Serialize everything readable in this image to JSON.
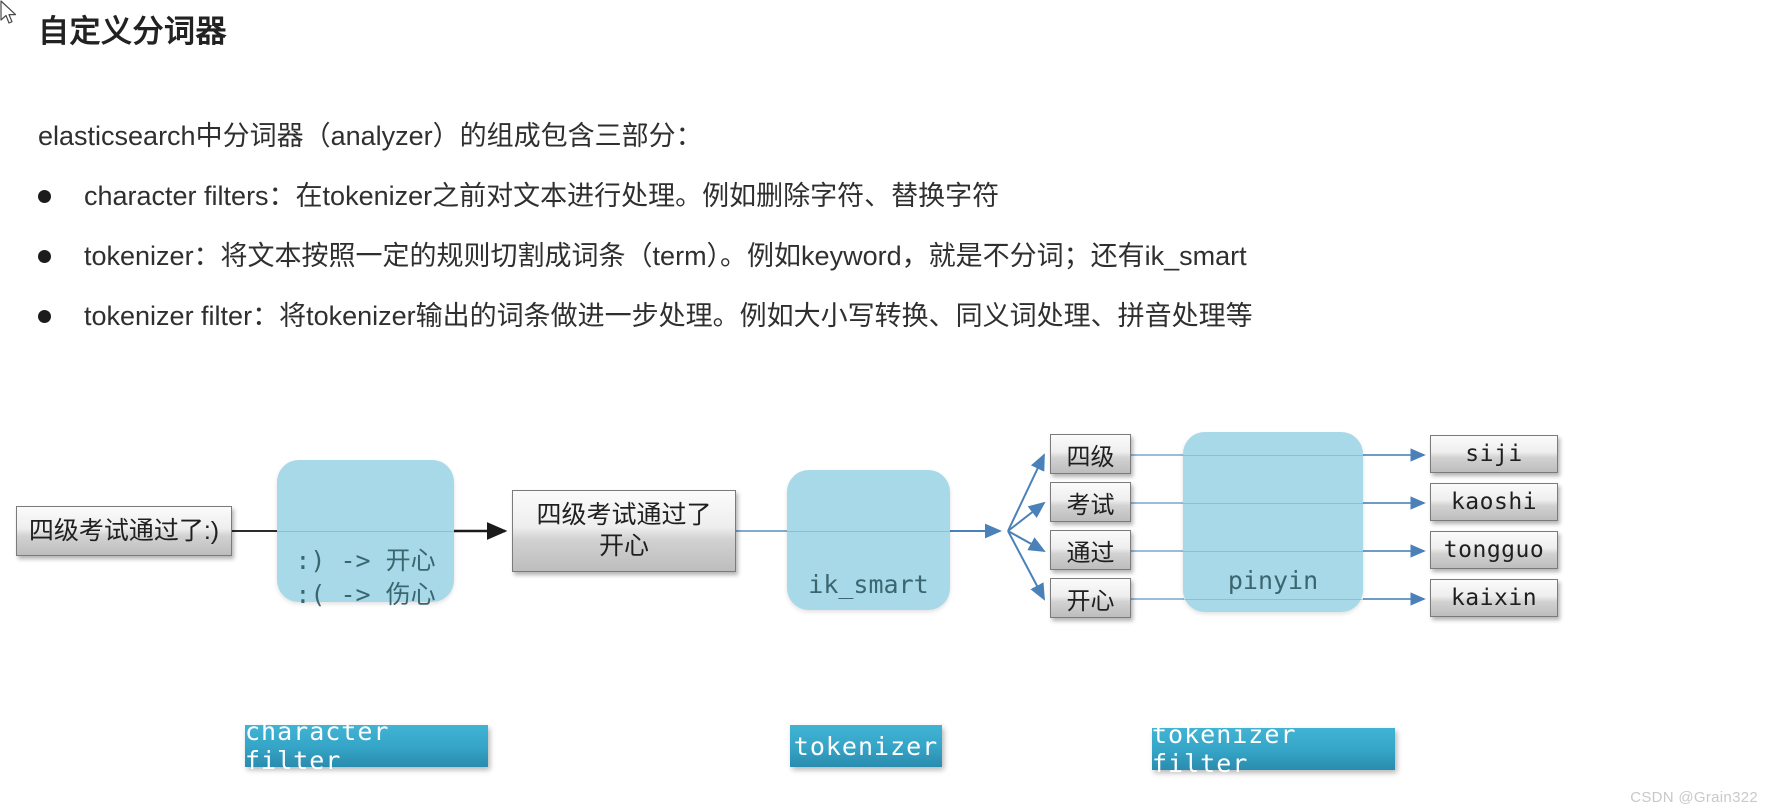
{
  "page_title": "自定义分词器",
  "intro": "elasticsearch中分词器（analyzer）的组成包含三部分：",
  "bullets": [
    "character filters：在tokenizer之前对文本进行处理。例如删除字符、替换字符",
    "tokenizer：将文本按照一定的规则切割成词条（term）。例如keyword，就是不分词；还有ik_smart",
    "tokenizer filter：将tokenizer输出的词条做进一步处理。例如大小写转换、同义词处理、拼音处理等"
  ],
  "diagram": {
    "input_box": "四级考试通过了:)",
    "char_filter_rules": [
      ":) -> 开心",
      ":( -> 伤心"
    ],
    "char_filter_caption": "character filter",
    "filtered_text": "四级考试通过了开心",
    "tokenizer_name": "ik_smart",
    "tokenizer_caption": "tokenizer",
    "terms": [
      "四级",
      "考试",
      "通过",
      "开心"
    ],
    "token_filter_name": "pinyin",
    "token_filter_caption": "tokenizer filter",
    "outputs": [
      "siji",
      "kaoshi",
      "tongguo",
      "kaixin"
    ]
  },
  "watermark": "CSDN @Grain322",
  "colors": {
    "process_fill": "#a7d9e8",
    "caption_chip": "#36a6c8",
    "arrow_blue": "#4a81b8",
    "arrow_black": "#1a1a1a",
    "box_border": "#7b7b7b"
  }
}
